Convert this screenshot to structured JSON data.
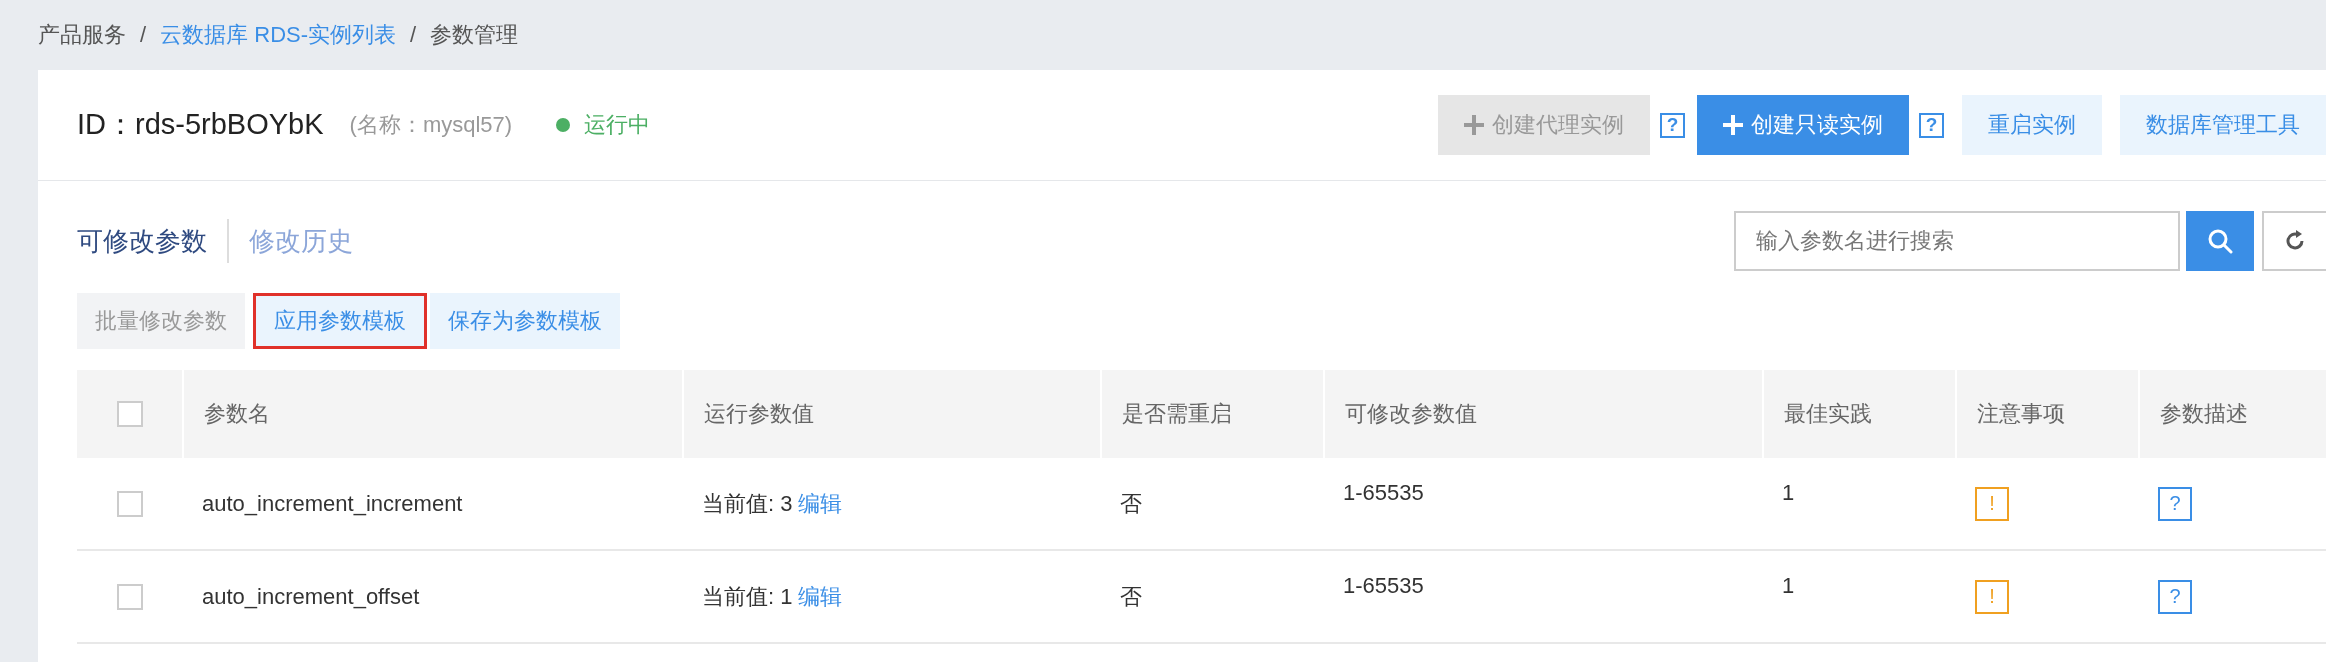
{
  "breadcrumb": [
    {
      "label": "产品服务",
      "link": false,
      "separator": "/"
    },
    {
      "label": "云数据库 RDS-实例列表",
      "link": true,
      "separator": "/"
    },
    {
      "label": "参数管理",
      "link": false
    }
  ],
  "instance": {
    "id_label": "ID：",
    "id": "rds-5rbBOYbK",
    "name": "(名称：mysql57)",
    "status": "运行中"
  },
  "actions": [
    {
      "label": "创建代理实例",
      "kind": "primary",
      "disabled": true,
      "help": "?"
    },
    {
      "label": "创建只读实例",
      "kind": "primary",
      "disabled": false,
      "help": "?"
    },
    {
      "label": "重启实例",
      "kind": "light",
      "disabled": false
    },
    {
      "label": "数据库管理工具",
      "kind": "light",
      "disabled": false
    }
  ],
  "tabs": [
    {
      "label": "可修改参数",
      "selected": true
    },
    {
      "label": "修改历史",
      "selected": false
    }
  ],
  "search": {
    "placeholder": "输入参数名进行搜索"
  },
  "toolbar": [
    {
      "label": "批量修改参数",
      "disabled": true,
      "highlighted": false
    },
    {
      "label": "应用参数模板",
      "disabled": false,
      "highlighted": true
    },
    {
      "label": "保存为参数模板",
      "disabled": false,
      "highlighted": false
    }
  ],
  "table": {
    "header_checked": false,
    "columns": [
      "参数名",
      "运行参数值",
      "是否需重启",
      "可修改参数值",
      "最佳实践",
      "注意事项",
      "参数描述"
    ],
    "rows": [
      {
        "checked": false,
        "name": "auto_increment_increment",
        "value": "当前值: 3",
        "edit": "编辑",
        "restart": "否",
        "range": "1-65535",
        "best": "1",
        "notice": "!",
        "desc": "?"
      },
      {
        "checked": false,
        "name": "auto_increment_offset",
        "value": "当前值: 1",
        "edit": "编辑",
        "restart": "否",
        "range": "1-65535",
        "best": "1",
        "notice": "!",
        "desc": "?"
      }
    ]
  }
}
